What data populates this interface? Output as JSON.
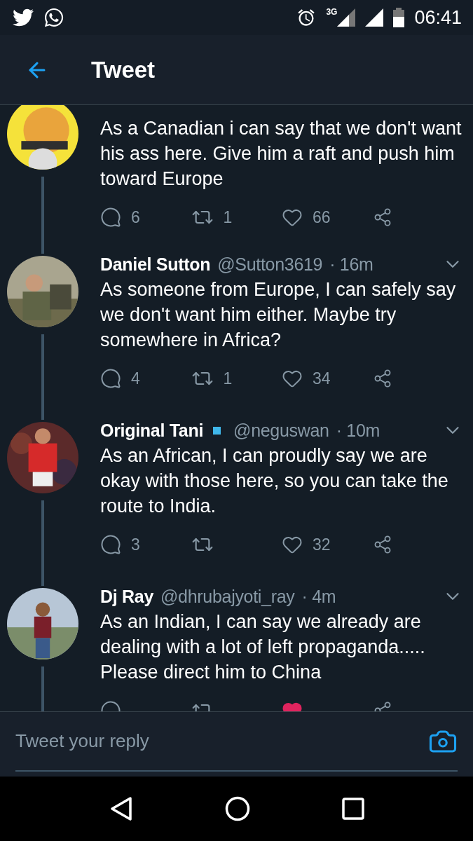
{
  "status_bar": {
    "network": "3G",
    "time": "06:41"
  },
  "header": {
    "title": "Tweet"
  },
  "tweets": [
    {
      "verified": false,
      "text": "As a Canadian i can say that we don't want his ass here. Give him a raft and push him toward Europe",
      "replies": "6",
      "retweets": "1",
      "likes": "66",
      "liked": false
    },
    {
      "name": "Daniel Sutton",
      "handle": "@Sutton3619",
      "time": "· 16m",
      "verified": false,
      "text": "As someone from Europe, I can safely say we don't want him either. Maybe try somewhere in Africa?",
      "replies": "4",
      "retweets": "1",
      "likes": "34",
      "liked": false
    },
    {
      "name": "Original Tani",
      "handle": "@neguswan",
      "time": "· 10m",
      "verified": true,
      "text": "As an African, I can proudly say we are okay with those here, so you can take the route to India.",
      "replies": "3",
      "likes": "32",
      "liked": false
    },
    {
      "name": "Dj Ray",
      "handle": "@dhrubajyoti_ray",
      "time": "· 4m",
      "verified": false,
      "text": "As an Indian, I can say we already are dealing with a lot of left propaganda..... Please direct him to China",
      "liked": true
    }
  ],
  "reply_bar": {
    "placeholder": "Tweet your reply"
  }
}
